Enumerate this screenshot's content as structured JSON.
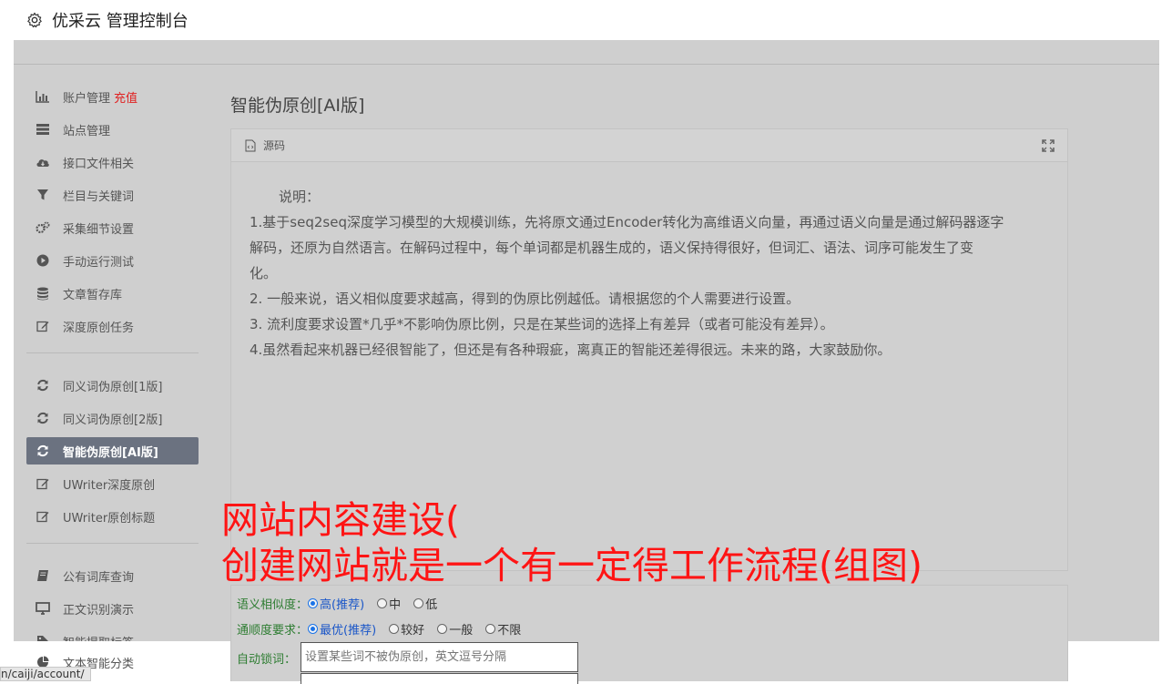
{
  "header": {
    "title": "优采云 管理控制台"
  },
  "sidebar": {
    "group1": [
      {
        "label": "账户管理",
        "extra": "充值",
        "icon": "bar-chart-icon"
      },
      {
        "label": "站点管理",
        "icon": "server-icon"
      },
      {
        "label": "接口文件相关",
        "icon": "cloud-download-icon"
      },
      {
        "label": "栏目与关键词",
        "icon": "filter-icon"
      },
      {
        "label": "采集细节设置",
        "icon": "gears-icon"
      },
      {
        "label": "手动运行测试",
        "icon": "play-circle-icon"
      },
      {
        "label": "文章暂存库",
        "icon": "database-icon"
      },
      {
        "label": "深度原创任务",
        "icon": "edit-icon"
      }
    ],
    "group2": [
      {
        "label": "同义词伪原创[1版]",
        "icon": "refresh-icon"
      },
      {
        "label": "同义词伪原创[2版]",
        "icon": "refresh-icon"
      },
      {
        "label": "智能伪原创[AI版]",
        "icon": "refresh-icon"
      },
      {
        "label": "UWriter深度原创",
        "icon": "edit-icon"
      },
      {
        "label": "UWriter原创标题",
        "icon": "edit-icon"
      }
    ],
    "group3": [
      {
        "label": "公有词库查询",
        "icon": "book-icon"
      },
      {
        "label": "正文识别演示",
        "icon": "desktop-icon"
      },
      {
        "label": "智能提取标签",
        "icon": "tag-icon"
      }
    ],
    "bottom_item": {
      "label": "文本智能分类",
      "icon": "pie-chart-icon"
    }
  },
  "main": {
    "page_title": "智能伪原创[AI版]",
    "panel": {
      "head_label": "源码",
      "lines": [
        "说明：",
        "1.基于seq2seq深度学习模型的大规模训练，先将原文通过Encoder转化为高维语义向量，再通过语义向量是通过解码器逐字",
        "解码，还原为自然语言。在解码过程中，每个单词都是机器生成的，语义保持得很好，但词汇、语法、词序可能发生了变",
        "化。",
        "2. 一般来说，语义相似度要求越高，得到的伪原比例越低。请根据您的个人需要进行设置。",
        "3. 流利度要求设置*几乎*不影响伪原比例，只是在某些词的选择上有差异（或者可能没有差异）。",
        "4.虽然看起来机器已经很智能了，但还是有各种瑕疵，离真正的智能还差得很远。未来的路，大家鼓励你。"
      ]
    },
    "form": {
      "similarity_label": "语义相似度：",
      "similarity_options": [
        "高(推荐)",
        "中",
        "低"
      ],
      "fluency_label": "通顺度要求：",
      "fluency_options": [
        "最优(推荐)",
        "较好",
        "一般",
        "不限"
      ],
      "lock_label": "自动锁词：",
      "lock_placeholder": "设置某些词不被伪原创，英文逗号分隔"
    }
  },
  "overlay": {
    "line1": "网站内容建设(",
    "line2": "创建网站就是一个有一定得工作流程(组图)"
  },
  "statusbar": {
    "url": "n/caiji/account/"
  }
}
